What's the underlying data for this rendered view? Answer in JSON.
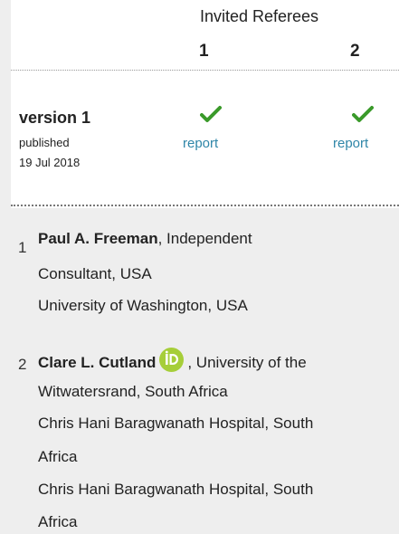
{
  "header": {
    "title": "Invited Referees",
    "referee_numbers": [
      "1",
      "2"
    ]
  },
  "version": {
    "label": "version 1",
    "status": "published",
    "date": "19 Jul 2018",
    "reports": [
      {
        "icon": "checkmark-icon",
        "label": "report",
        "color": "#3a9a2a"
      },
      {
        "icon": "checkmark-icon",
        "label": "report",
        "color": "#3a9a2a"
      }
    ]
  },
  "referees": [
    {
      "number": "1",
      "name": "Paul A. Freeman",
      "affiliation_suffix": ", Independent",
      "lines": [
        "Consultant, USA",
        "University of Washington, USA"
      ]
    },
    {
      "number": "2",
      "name": "Clare L. Cutland",
      "orcid_icon": "orcid-icon",
      "affiliation_suffix": ", University of the",
      "lines": [
        "Witwatersrand, South Africa",
        "Chris Hani Baragwanath Hospital, South",
        "Africa",
        "Chris Hani Baragwanath Hospital, South",
        "Africa"
      ]
    }
  ],
  "colors": {
    "link": "#2f86a8",
    "check": "#3a9a2a",
    "orcid": "#a6ce39",
    "panel_bg": "#eeeeee"
  }
}
